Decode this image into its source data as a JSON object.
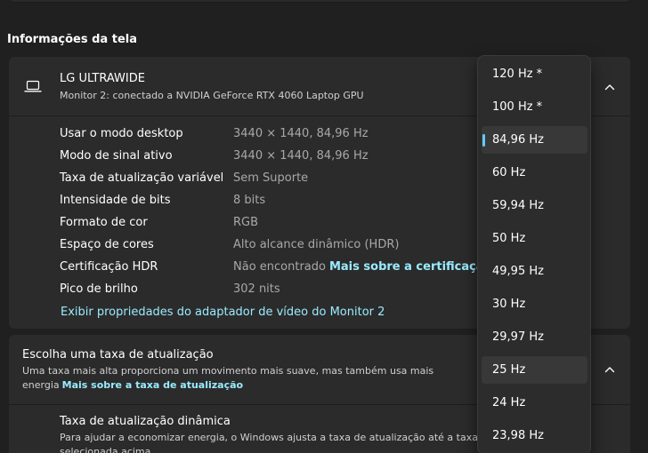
{
  "section": {
    "heading": "Informações da tela"
  },
  "monitor": {
    "name": "LG ULTRAWIDE",
    "description": "Monitor 2: conectado a NVIDIA GeForce RTX 4060 Laptop GPU",
    "properties": [
      {
        "label": "Usar o modo desktop",
        "value": "3440 × 1440, 84,96 Hz"
      },
      {
        "label": "Modo de sinal ativo",
        "value": "3440 × 1440, 84,96 Hz"
      },
      {
        "label": "Taxa de atualização variável",
        "value": "Sem Suporte"
      },
      {
        "label": "Intensidade de bits",
        "value": "8 bits"
      },
      {
        "label": "Formato de cor",
        "value": "RGB"
      },
      {
        "label": "Espaço de cores",
        "value": "Alto alcance dinâmico (HDR)"
      },
      {
        "label": "Certificação HDR",
        "value": "Não encontrado",
        "link": "Mais sobre a certificação H"
      },
      {
        "label": "Pico de brilho",
        "value": "302 nits"
      }
    ],
    "adapter_link": "Exibir propriedades do adaptador de vídeo do Monitor 2"
  },
  "refresh": {
    "title": "Escolha uma taxa de atualização",
    "description": "Uma taxa mais alta proporciona um movimento mais suave, mas também usa mais energia",
    "link": "Mais sobre a taxa de atualização",
    "dynamic_title": "Taxa de atualização dinâmica",
    "dynamic_description": "Para ajudar a economizar energia, o Windows ajusta a taxa de atualização até a taxa selecionada acima"
  },
  "dropdown": {
    "options": [
      "120 Hz *",
      "100 Hz *",
      "84,96 Hz",
      "60 Hz",
      "59,94 Hz",
      "50 Hz",
      "49,95 Hz",
      "30 Hz",
      "29,97 Hz",
      "25 Hz",
      "24 Hz",
      "23,98 Hz"
    ],
    "selected": "84,96 Hz",
    "hovered": "25 Hz"
  },
  "colors": {
    "background": "#202020",
    "card": "#2b2b2b",
    "link": "#99ebff",
    "accent": "#60cdff"
  }
}
